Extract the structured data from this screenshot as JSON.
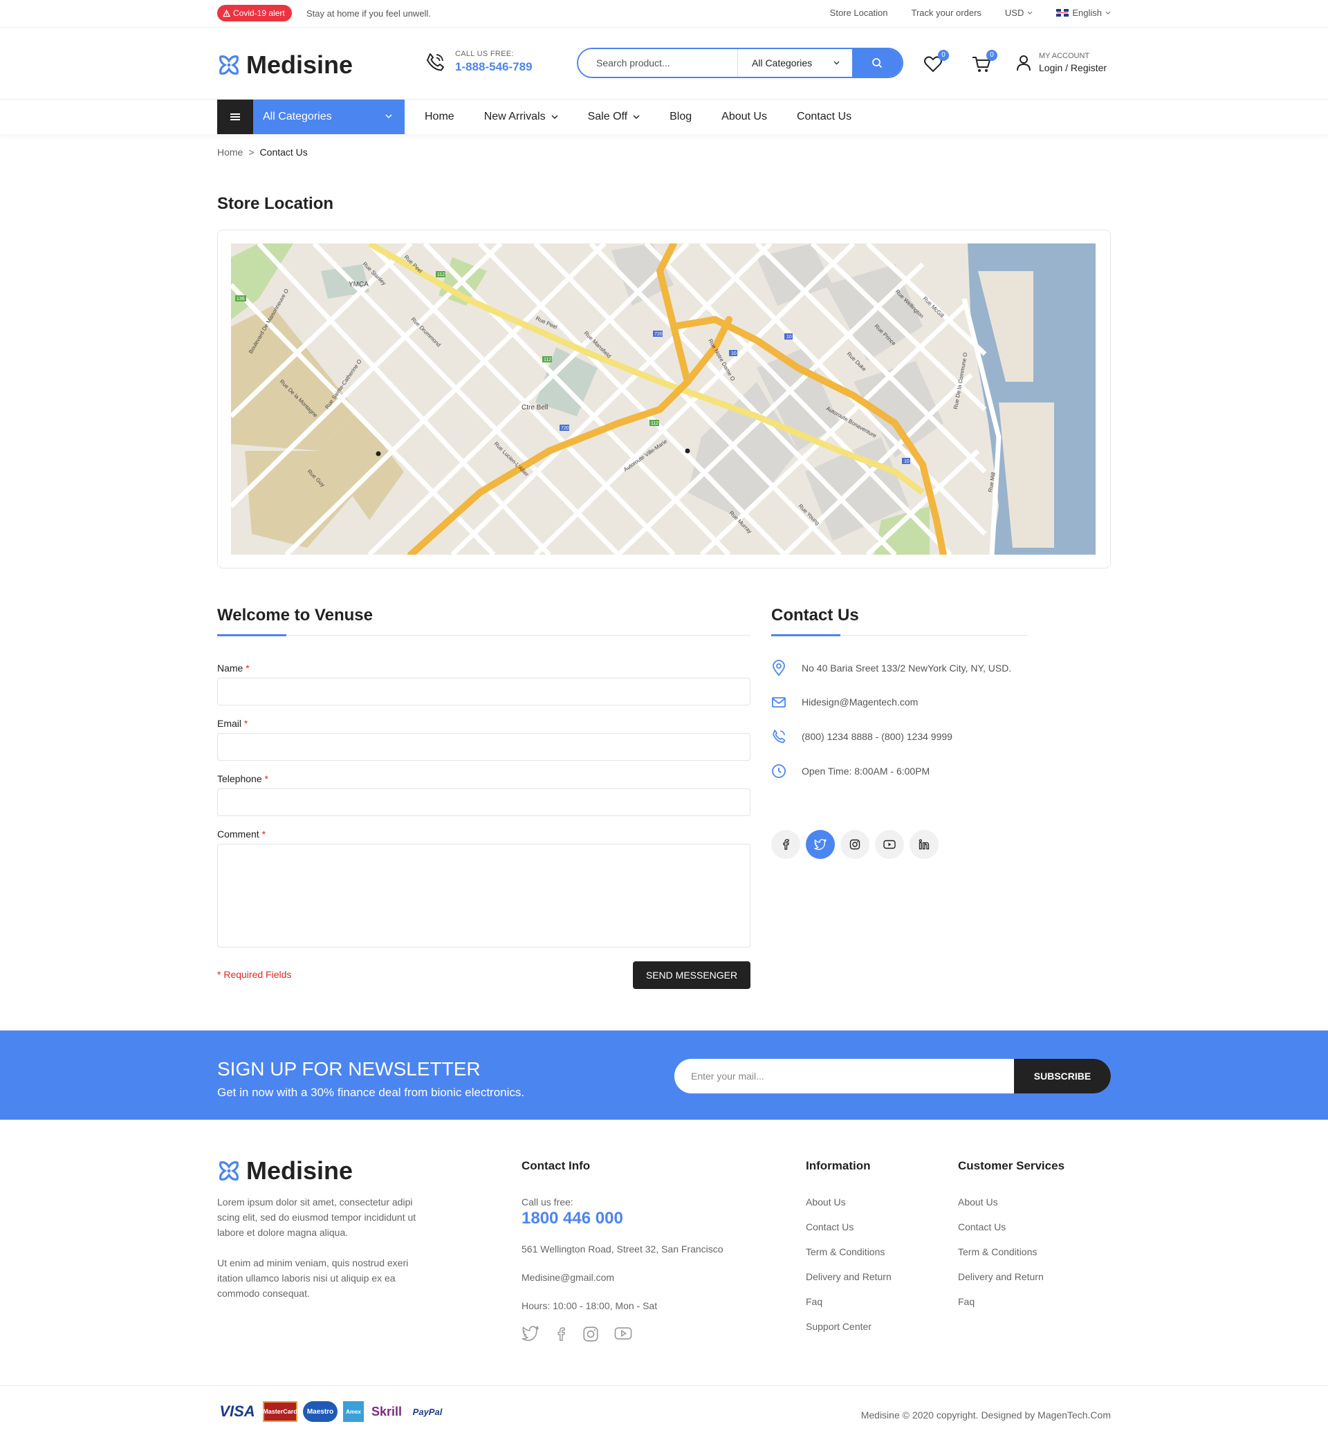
{
  "topbar": {
    "covid_badge": "Covid-19 alert",
    "covid_text": "Stay at home if you feel unwell.",
    "links": [
      "Store Location",
      "Track your orders"
    ],
    "currency": "USD",
    "language": "English"
  },
  "header": {
    "logo": "Medisine",
    "call_label": "CALL US FREE:",
    "call_number": "1-888-546-789",
    "search_placeholder": "Search product...",
    "search_category": "All Categories",
    "wishlist_count": "0",
    "cart_count": "0",
    "account_label": "MY ACCOUNT",
    "account_link": "Login / Register"
  },
  "nav": {
    "all_categories": "All Categories",
    "items": [
      "Home",
      "New Arrivals",
      "Sale Off",
      "Blog",
      "About Us",
      "Contact Us"
    ]
  },
  "breadcrumb": {
    "home": "Home",
    "current": "Contact Us"
  },
  "store": {
    "title": "Store Location",
    "map_labels": [
      "YMCA",
      "Rue Peel",
      "Rue Stanley",
      "Rue Metcalfe",
      "Rue Mansfield",
      "Autoroute Ville-Marie",
      "Autoroute Bonaventure",
      "Ctre Bell",
      "Rue Guy",
      "Rue Bishop",
      "Rue Mackay",
      "Rue Notre Dame O",
      "Rue Saint-Jacques",
      "Rue Duke",
      "Rue Prince",
      "Rue Wellington",
      "Rue Ottawa",
      "Rue Nazareth",
      "Rue Young",
      "Rue Eleanor",
      "Rue Murray",
      "Rue Mill",
      "Rue De la Commune O",
      "Rue Saint-Antoine",
      "Rue Lucien-L'Allier",
      "Boulevard De Maisonneuve O",
      "Rue Sainte-Catherine O",
      "Rue De la Montagne",
      "Rue Drummond",
      "Rue Stanley"
    ],
    "map_highways": [
      "720",
      "10",
      "112",
      "136"
    ]
  },
  "form": {
    "title": "Welcome to Venuse",
    "name_label": "Name",
    "email_label": "Email",
    "telephone_label": "Telephone",
    "comment_label": "Comment",
    "required_marker": "*",
    "required_note": "* Required Fields",
    "submit_label": "SEND MESSENGER"
  },
  "contact": {
    "title": "Contact Us",
    "address": "No 40 Baria Sreet 133/2 NewYork City, NY, USD.",
    "email": "Hidesign@Magentech.com",
    "phone": "(800) 1234 8888 - (800) 1234 9999",
    "hours": "Open Time: 8:00AM - 6:00PM",
    "socials": [
      "facebook-icon",
      "twitter-icon",
      "instagram-icon",
      "youtube-icon",
      "linkedin-icon"
    ]
  },
  "newsletter": {
    "title": "SIGN UP FOR NEWSLETTER",
    "subtitle": "Get in now with a 30% finance deal from bionic electronics.",
    "placeholder": "Enter your mail...",
    "button": "SUBSCRIBE"
  },
  "footer": {
    "logo": "Medisine",
    "para1": "Lorem ipsum dolor sit amet, consectetur adipi scing elit, sed do eiusmod tempor incididunt ut labore et dolore magna aliqua.",
    "para2": "Ut enim ad minim veniam, quis nostrud exeri itation ullamco laboris nisi ut aliquip ex ea commodo consequat.",
    "contact_title": "Contact Info",
    "call_label": "Call us free:",
    "call_number": "1800 446 000",
    "address": "561 Wellington Road, Street 32, San Francisco",
    "email": "Medisine@gmail.com",
    "hours": "Hours: 10:00 - 18:00, Mon - Sat",
    "info_title": "Information",
    "info_links": [
      "About Us",
      "Contact Us",
      "Term & Conditions",
      "Delivery and Return",
      "Faq",
      "Support Center"
    ],
    "cs_title": "Customer Services",
    "cs_links": [
      "About Us",
      "Contact Us",
      "Term & Conditions",
      "Delivery and Return",
      "Faq"
    ],
    "payments": [
      "VISA",
      "MasterCard",
      "Maestro",
      "Amex",
      "Skrill",
      "PayPal"
    ],
    "copyright": "Medisine © 2020 copyright. Designed by MagenTech.Com"
  },
  "colors": {
    "accent": "#4b85f0",
    "dark": "#222222",
    "alert": "#ec3340"
  }
}
